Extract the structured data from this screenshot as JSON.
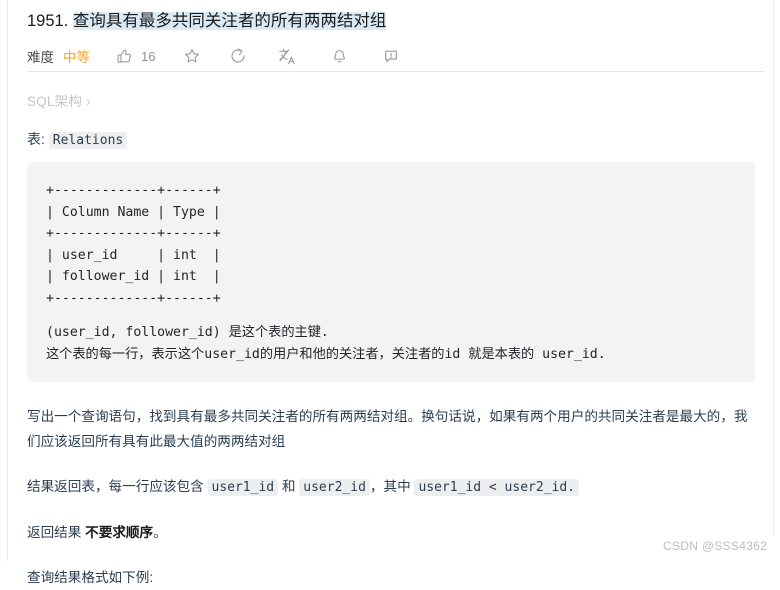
{
  "problem": {
    "number": "1951.",
    "title": "查询具有最多共同关注者的所有两两结对组",
    "difficulty_label": "难度",
    "difficulty_value": "中等",
    "like_count": "16"
  },
  "toolbar": {
    "like_icon": "thumbs-up-icon",
    "favorite_icon": "star-icon",
    "share_icon": "share-circle-icon",
    "translate_icon": "translate-icon",
    "notify_icon": "bell-icon",
    "feedback_icon": "feedback-bubble-icon"
  },
  "breadcrumb": {
    "label": "SQL架构",
    "chevron": "›"
  },
  "schema": {
    "table_prefix": "表:",
    "table_name": "Relations",
    "ascii_table": "+-------------+------+\n| Column Name | Type |\n+-------------+------+\n| user_id     | int  |\n| follower_id | int  |\n+-------------+------+",
    "note_line_1": "(user_id, follower_id) 是这个表的主键.",
    "note_line_2": "这个表的每一行，表示这个user_id的用户和他的关注者，关注者的id 就是本表的 user_id."
  },
  "description": {
    "paragraph_1": "写出一个查询语句，找到具有最多共同关注者的所有两两结对组。换句话说，如果有两个用户的共同关注者是最大的，我们应该返回所有具有此最大值的两两结对组",
    "result_prefix": "结果返回表，每一行应该包含",
    "code_user1": "user1_id",
    "result_conj": "和",
    "code_user2": "user2_id",
    "result_mid": "，其中",
    "code_condition": "user1_id < user2_id.",
    "order_prefix": "返回结果",
    "order_bold": "不要求顺序",
    "order_suffix": "。",
    "example_intro": "查询结果格式如下例:"
  },
  "watermark": {
    "text": "CSDN @SSS4362"
  }
}
